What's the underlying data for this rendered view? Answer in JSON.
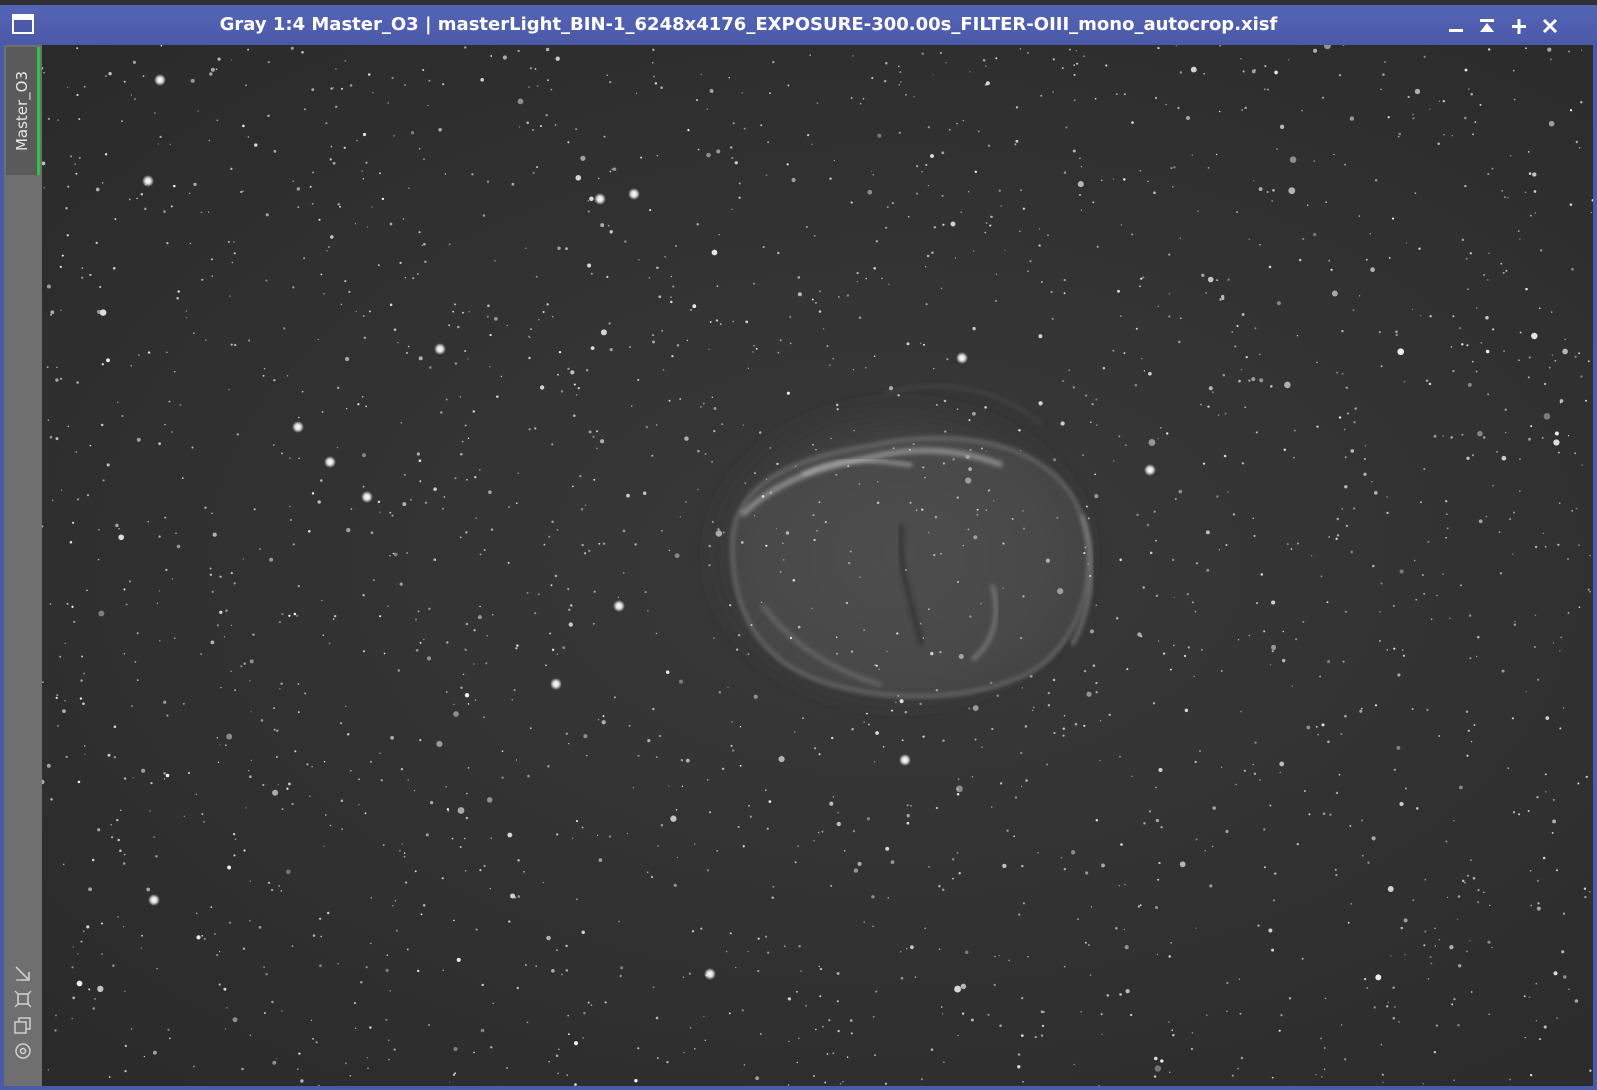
{
  "window": {
    "title": "Gray 1:4 Master_O3 | masterLight_BIN-1_6248x4176_EXPOSURE-300.00s_FILTER-OIII_mono_autocrop.xisf",
    "buttons": [
      {
        "name": "minimize",
        "glyph": "−"
      },
      {
        "name": "shade",
        "glyph": "⤒"
      },
      {
        "name": "maximize",
        "glyph": "+"
      },
      {
        "name": "close",
        "glyph": "✕"
      }
    ]
  },
  "sidebar": {
    "tab_label": "Master_O3",
    "tools": [
      {
        "name": "fit-view-icon",
        "glyph": "↘"
      },
      {
        "name": "zoom-to-fit-icon",
        "glyph": "⌗"
      },
      {
        "name": "clone-view-icon",
        "glyph": "⧉"
      },
      {
        "name": "target-icon",
        "glyph": "◎"
      }
    ]
  },
  "colors": {
    "titlebar": "#4a59a8",
    "tab_accent": "#2ec24a",
    "sky": "#313131"
  }
}
